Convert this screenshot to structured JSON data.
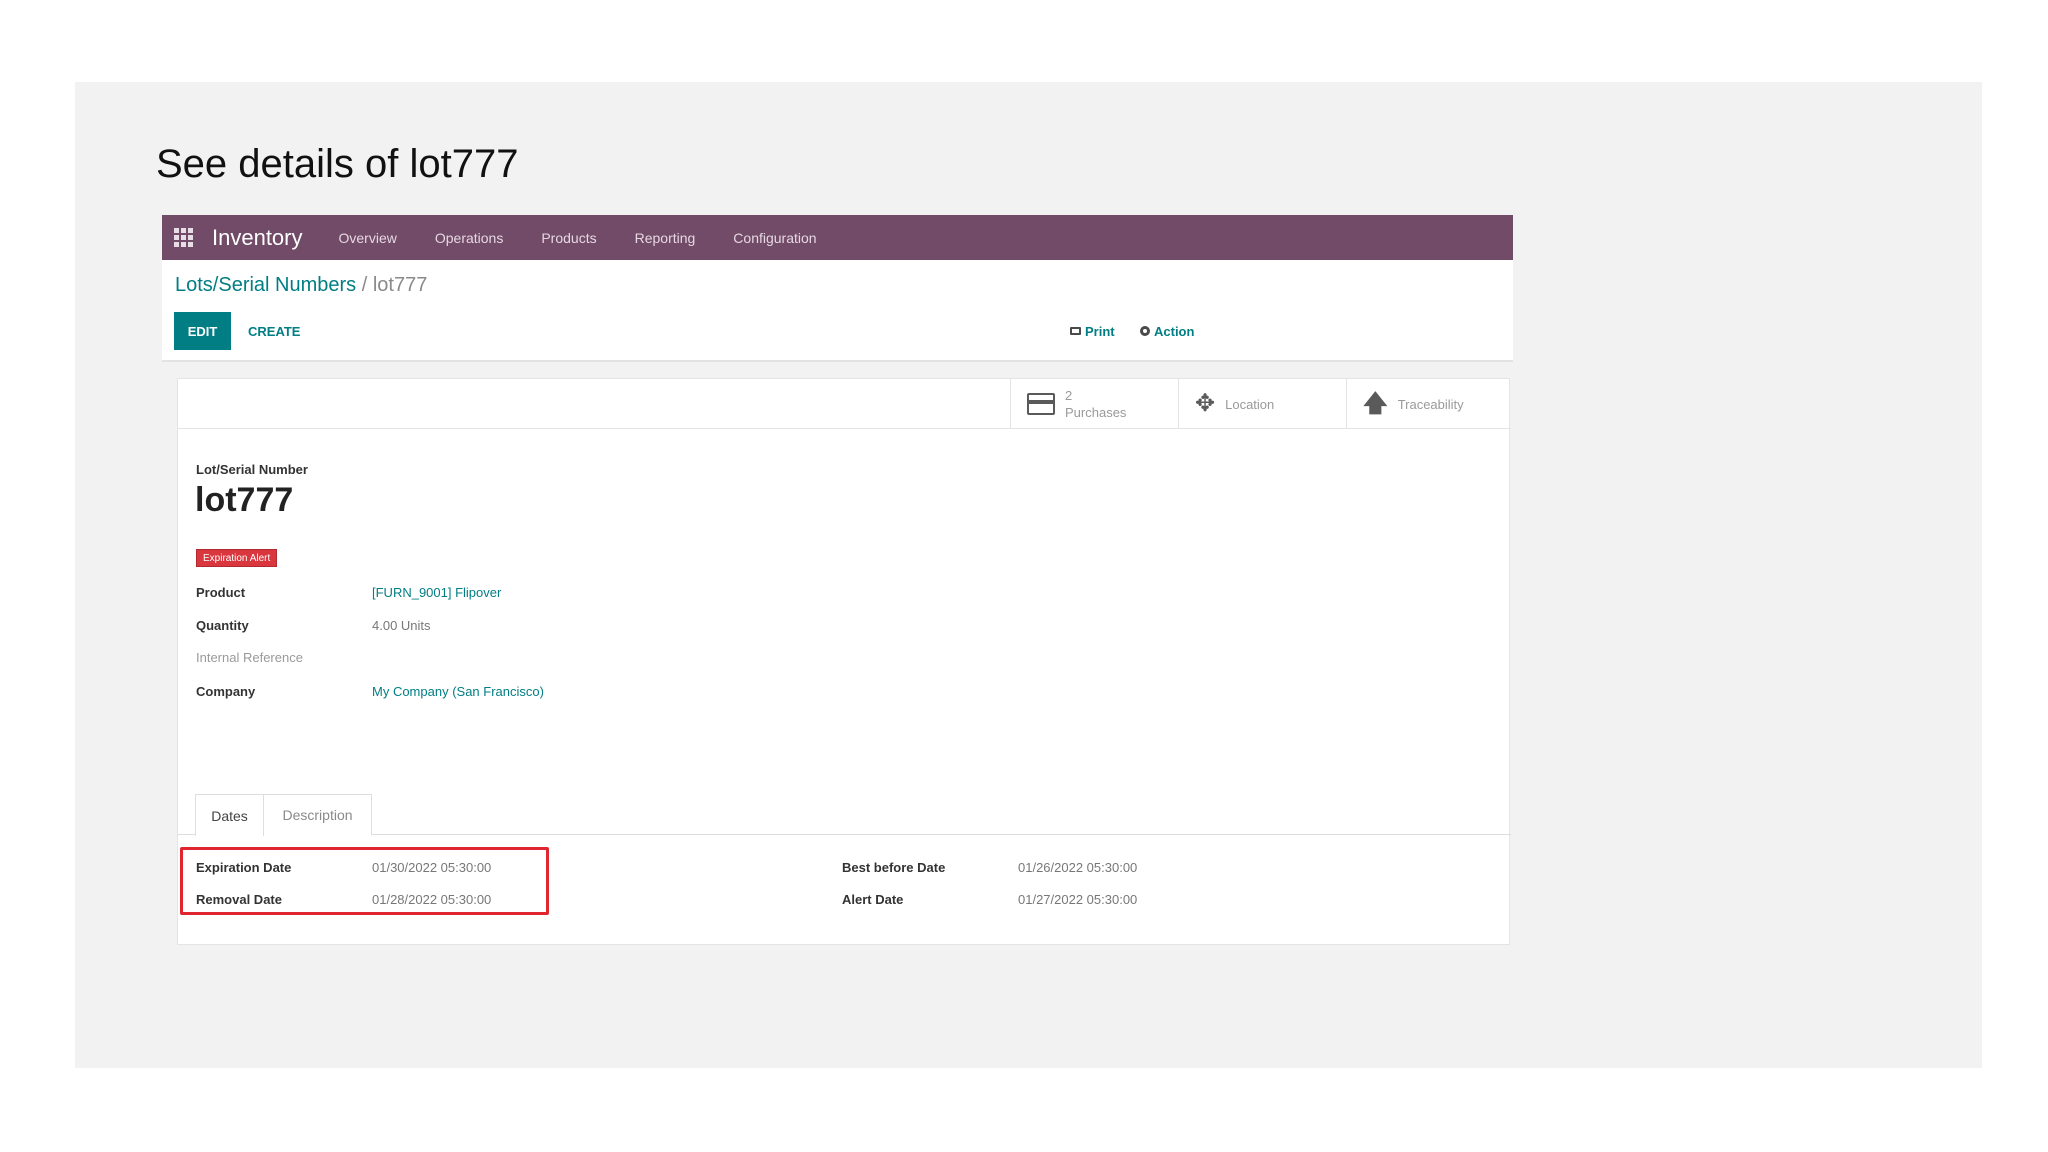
{
  "slide": {
    "title": "See details of lot777"
  },
  "navbar": {
    "brand": "Inventory",
    "menu": [
      "Overview",
      "Operations",
      "Products",
      "Reporting",
      "Configuration"
    ]
  },
  "breadcrumb": {
    "parent": "Lots/Serial Numbers",
    "separator": " / ",
    "current": "lot777"
  },
  "toolbar": {
    "edit_label": "EDIT",
    "create_label": "CREATE",
    "print_label": "Print",
    "action_label": "Action"
  },
  "smart_buttons": {
    "purchases_count": "2",
    "purchases_label": "Purchases",
    "location_label": "Location",
    "traceability_label": "Traceability"
  },
  "record": {
    "caption": "Lot/Serial Number",
    "name": "lot777",
    "badge": "Expiration Alert",
    "fields": {
      "product_label": "Product",
      "product_value": "[FURN_9001] Flipover",
      "quantity_label": "Quantity",
      "quantity_value": "4.00 Units",
      "internal_ref_label": "Internal Reference",
      "company_label": "Company",
      "company_value": "My Company (San Francisco)"
    }
  },
  "tabs": {
    "dates": "Dates",
    "description": "Description"
  },
  "dates": {
    "expiration_label": "Expiration Date",
    "expiration_value": "01/30/2022 05:30:00",
    "removal_label": "Removal Date",
    "removal_value": "01/28/2022 05:30:00",
    "best_before_label": "Best before Date",
    "best_before_value": "01/26/2022 05:30:00",
    "alert_label": "Alert Date",
    "alert_value": "01/27/2022 05:30:00"
  },
  "colors": {
    "navbar": "#714b67",
    "primary": "#017e84",
    "badge": "#d9363e",
    "highlight": "#e0262f"
  }
}
